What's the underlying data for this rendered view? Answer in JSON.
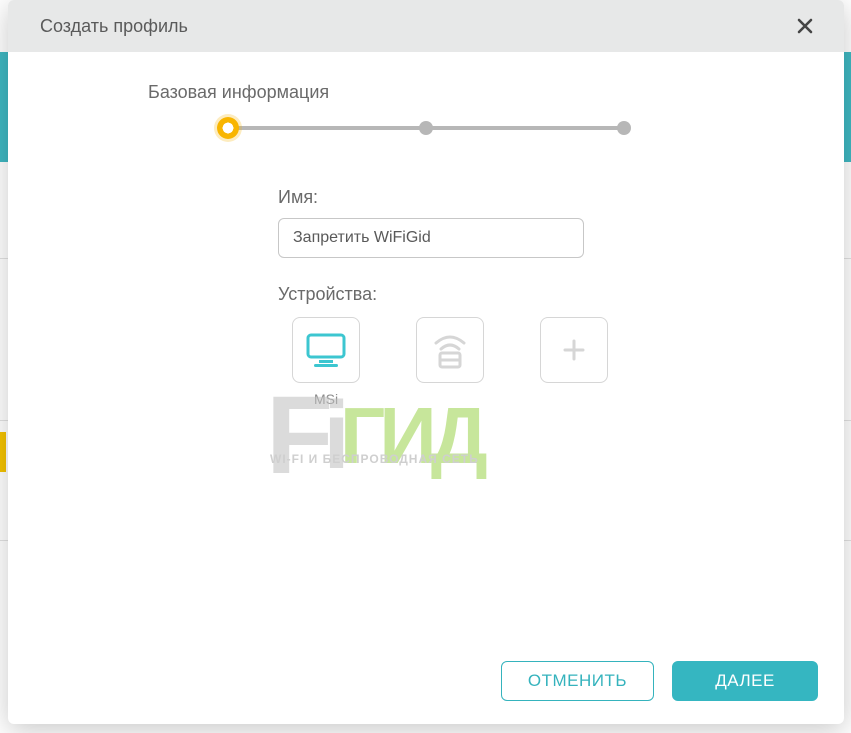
{
  "modal": {
    "title": "Создать профиль",
    "step_label": "Базовая информация",
    "fields": {
      "name_label": "Имя:",
      "name_value": "Запретить WiFiGid",
      "devices_label": "Устройства:"
    },
    "devices": [
      {
        "id": "msi",
        "caption": "MSi",
        "icon": "monitor",
        "selected": true
      },
      {
        "id": "wifi",
        "caption": "",
        "icon": "wifi",
        "selected": false
      },
      {
        "id": "add",
        "caption": "",
        "icon": "plus",
        "selected": false
      }
    ],
    "buttons": {
      "cancel": "ОТМЕНИТЬ",
      "next": "ДАЛЕЕ"
    }
  },
  "watermark": {
    "brand_letters": "ГИД",
    "subtitle": "WI-FI И БЕСПРОВОДНАЯ СЕТЬ"
  },
  "colors": {
    "accent": "#35b6c1",
    "step_active": "#f8b500",
    "wm_green": "#9bd24a"
  }
}
